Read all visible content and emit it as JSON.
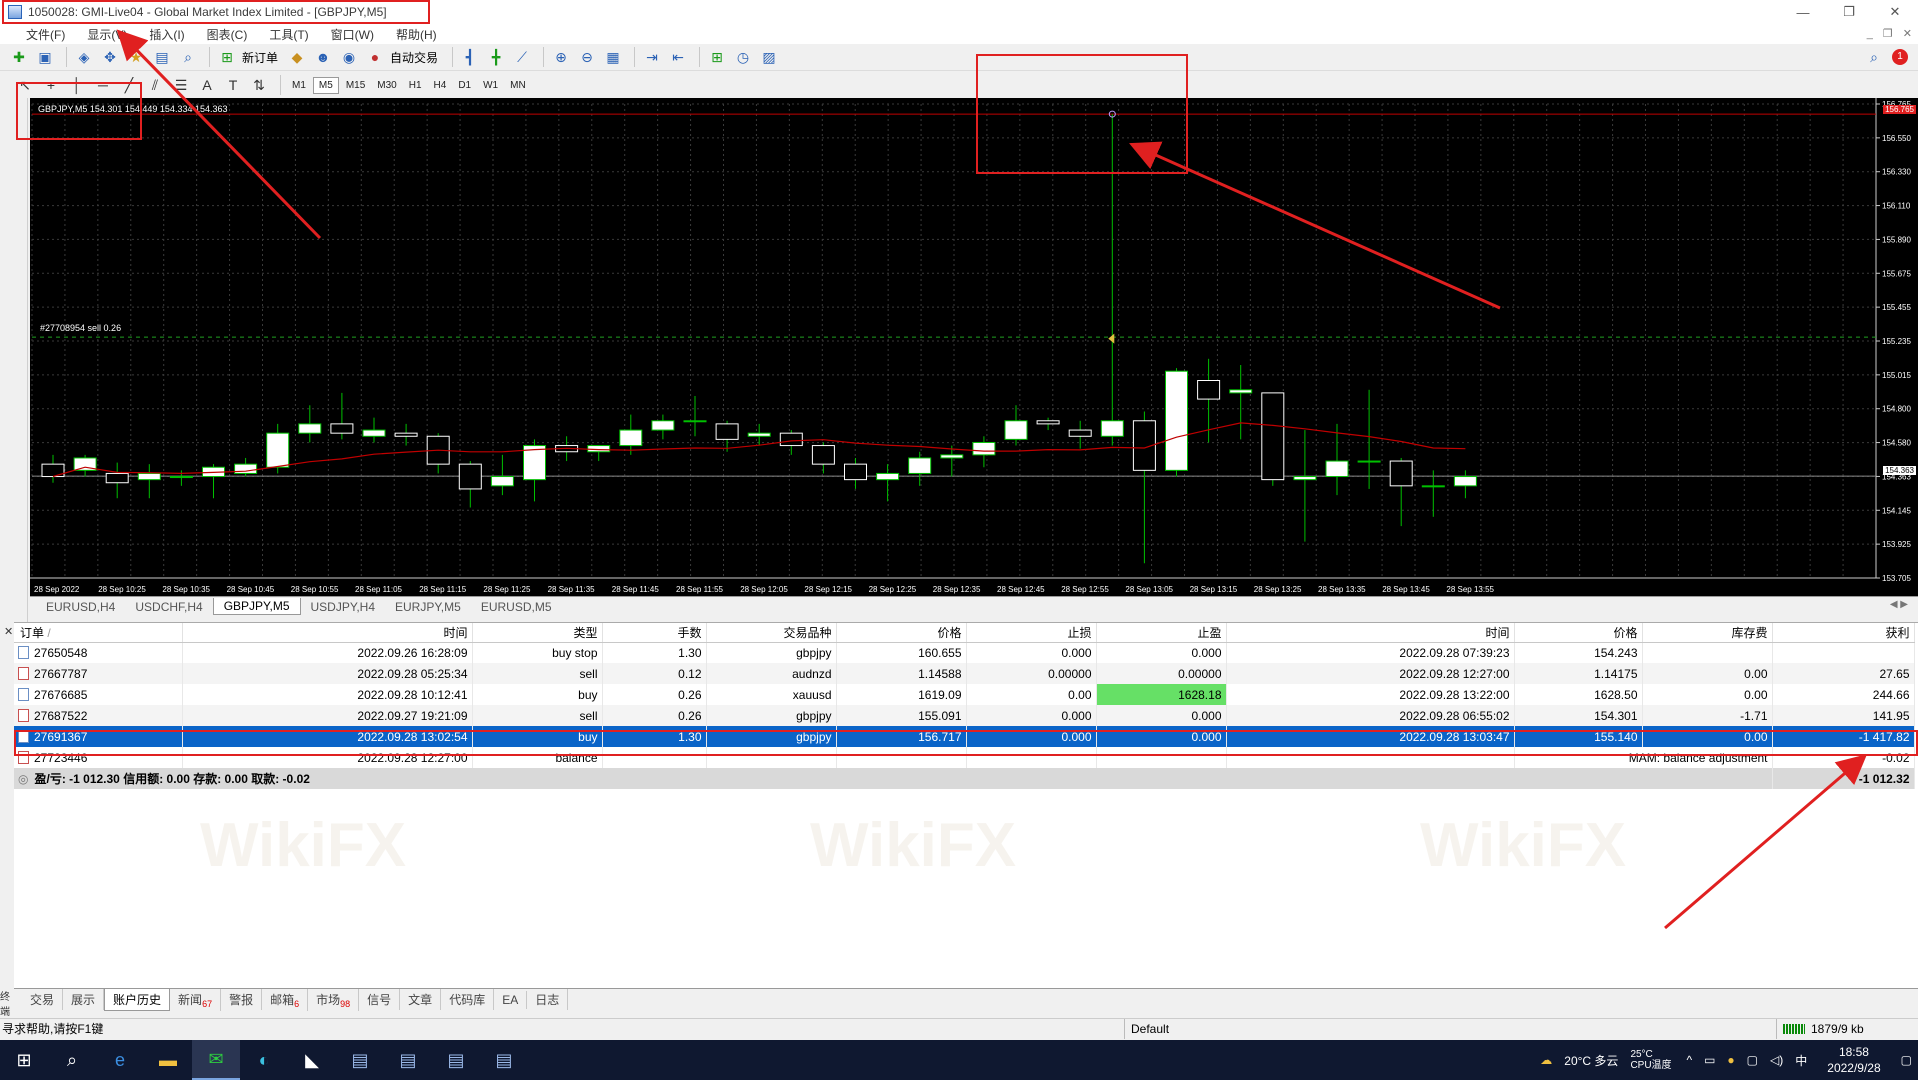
{
  "window": {
    "title": "1050028: GMI-Live04 - Global Market Index Limited - [GBPJPY,M5]",
    "controls": [
      "—",
      "❐",
      "✕"
    ]
  },
  "menu": {
    "items": [
      "文件(F)",
      "显示(V)",
      "插入(I)",
      "图表(C)",
      "工具(T)",
      "窗口(W)",
      "帮助(H)"
    ]
  },
  "toolbar": {
    "new_order_label": "新订单",
    "auto_trade_label": "自动交易"
  },
  "timeframes": [
    "M1",
    "M5",
    "M15",
    "M30",
    "H1",
    "H4",
    "D1",
    "W1",
    "MN"
  ],
  "active_timeframe": "M5",
  "chart": {
    "header": "GBPJPY,M5  154.301 154.449 154.334 154.363",
    "order_line_label": "#27708954 sell 0.26",
    "current_price": "154.363",
    "top_price": "156.765"
  },
  "chart_data": {
    "type": "candlestick",
    "symbol": "GBPJPY",
    "timeframe": "M5",
    "price_ticks": [
      "156.765",
      "156.550",
      "156.330",
      "156.110",
      "155.890",
      "155.675",
      "155.455",
      "155.235",
      "155.015",
      "154.800",
      "154.580",
      "154.363",
      "154.145",
      "153.925",
      "153.705"
    ],
    "time_ticks": [
      "28 Sep 2022",
      "28 Sep 10:25",
      "28 Sep 10:35",
      "28 Sep 10:45",
      "28 Sep 10:55",
      "28 Sep 11:05",
      "28 Sep 11:15",
      "28 Sep 11:25",
      "28 Sep 11:35",
      "28 Sep 11:45",
      "28 Sep 11:55",
      "28 Sep 12:05",
      "28 Sep 12:15",
      "28 Sep 12:25",
      "28 Sep 12:35",
      "28 Sep 12:45",
      "28 Sep 12:55",
      "28 Sep 13:05",
      "28 Sep 13:15",
      "28 Sep 13:25",
      "28 Sep 13:35",
      "28 Sep 13:45",
      "28 Sep 13:55"
    ],
    "ylim": [
      153.705,
      156.765
    ],
    "order_line_price": 155.26,
    "candles": [
      {
        "o": 154.44,
        "h": 154.5,
        "c": 154.36,
        "l": 154.32
      },
      {
        "o": 154.4,
        "h": 154.5,
        "c": 154.48,
        "l": 154.36
      },
      {
        "o": 154.38,
        "h": 154.45,
        "c": 154.32,
        "l": 154.22
      },
      {
        "o": 154.34,
        "h": 154.44,
        "c": 154.38,
        "l": 154.22
      },
      {
        "o": 154.36,
        "h": 154.4,
        "c": 154.36,
        "l": 154.3
      },
      {
        "o": 154.36,
        "h": 154.44,
        "c": 154.42,
        "l": 154.22
      },
      {
        "o": 154.38,
        "h": 154.48,
        "c": 154.44,
        "l": 154.36
      },
      {
        "o": 154.42,
        "h": 154.7,
        "c": 154.64,
        "l": 154.38
      },
      {
        "o": 154.64,
        "h": 154.82,
        "c": 154.7,
        "l": 154.58
      },
      {
        "o": 154.7,
        "h": 154.9,
        "c": 154.64,
        "l": 154.6
      },
      {
        "o": 154.62,
        "h": 154.74,
        "c": 154.66,
        "l": 154.58
      },
      {
        "o": 154.64,
        "h": 154.7,
        "c": 154.62,
        "l": 154.56
      },
      {
        "o": 154.62,
        "h": 154.64,
        "c": 154.44,
        "l": 154.38
      },
      {
        "o": 154.44,
        "h": 154.46,
        "c": 154.28,
        "l": 154.16
      },
      {
        "o": 154.3,
        "h": 154.5,
        "c": 154.36,
        "l": 154.24
      },
      {
        "o": 154.34,
        "h": 154.6,
        "c": 154.56,
        "l": 154.2
      },
      {
        "o": 154.56,
        "h": 154.62,
        "c": 154.52,
        "l": 154.46
      },
      {
        "o": 154.52,
        "h": 154.56,
        "c": 154.56,
        "l": 154.46
      },
      {
        "o": 154.56,
        "h": 154.76,
        "c": 154.66,
        "l": 154.5
      },
      {
        "o": 154.66,
        "h": 154.76,
        "c": 154.72,
        "l": 154.6
      },
      {
        "o": 154.72,
        "h": 154.88,
        "c": 154.72,
        "l": 154.62
      },
      {
        "o": 154.7,
        "h": 154.72,
        "c": 154.6,
        "l": 154.52
      },
      {
        "o": 154.62,
        "h": 154.7,
        "c": 154.64,
        "l": 154.56
      },
      {
        "o": 154.64,
        "h": 154.66,
        "c": 154.56,
        "l": 154.5
      },
      {
        "o": 154.56,
        "h": 154.58,
        "c": 154.44,
        "l": 154.38
      },
      {
        "o": 154.44,
        "h": 154.48,
        "c": 154.34,
        "l": 154.28
      },
      {
        "o": 154.34,
        "h": 154.44,
        "c": 154.38,
        "l": 154.2
      },
      {
        "o": 154.38,
        "h": 154.52,
        "c": 154.48,
        "l": 154.3
      },
      {
        "o": 154.48,
        "h": 154.56,
        "c": 154.5,
        "l": 154.36
      },
      {
        "o": 154.5,
        "h": 154.62,
        "c": 154.58,
        "l": 154.42
      },
      {
        "o": 154.6,
        "h": 154.82,
        "c": 154.72,
        "l": 154.56
      },
      {
        "o": 154.72,
        "h": 154.74,
        "c": 154.7,
        "l": 154.66
      },
      {
        "o": 154.66,
        "h": 154.72,
        "c": 154.62,
        "l": 154.54
      },
      {
        "o": 154.62,
        "h": 156.7,
        "c": 154.72,
        "l": 154.56
      },
      {
        "o": 154.72,
        "h": 154.78,
        "c": 154.4,
        "l": 153.8
      },
      {
        "o": 154.4,
        "h": 155.06,
        "c": 155.04,
        "l": 154.36
      },
      {
        "o": 154.98,
        "h": 155.12,
        "c": 154.86,
        "l": 154.58
      },
      {
        "o": 154.9,
        "h": 155.08,
        "c": 154.92,
        "l": 154.6
      },
      {
        "o": 154.9,
        "h": 154.9,
        "c": 154.34,
        "l": 154.3
      },
      {
        "o": 154.34,
        "h": 154.66,
        "c": 154.36,
        "l": 153.94
      },
      {
        "o": 154.36,
        "h": 154.7,
        "c": 154.46,
        "l": 154.24
      },
      {
        "o": 154.46,
        "h": 154.92,
        "c": 154.46,
        "l": 154.28
      },
      {
        "o": 154.46,
        "h": 154.48,
        "c": 154.3,
        "l": 154.04
      },
      {
        "o": 154.3,
        "h": 154.4,
        "c": 154.3,
        "l": 154.1
      },
      {
        "o": 154.3,
        "h": 154.4,
        "c": 154.36,
        "l": 154.22
      }
    ]
  },
  "chart_tabs": [
    "EURUSD,H4",
    "USDCHF,H4",
    "GBPJPY,M5",
    "USDJPY,H4",
    "EURJPY,M5",
    "EURUSD,M5"
  ],
  "active_chart_tab": "GBPJPY,M5",
  "history": {
    "columns": [
      "订单",
      "时间",
      "类型",
      "手数",
      "交易品种",
      "价格",
      "止损",
      "止盈",
      "时间",
      "价格",
      "库存费",
      "获利"
    ],
    "rows": [
      {
        "ticket": "27650548",
        "open_time": "2022.09.26 16:28:09",
        "type": "buy stop",
        "lots": "1.30",
        "symbol": "gbpjpy",
        "open_price": "160.655",
        "sl": "0.000",
        "tp": "0.000",
        "close_time": "2022.09.28 07:39:23",
        "close_price": "154.243",
        "swap": "",
        "profit": ""
      },
      {
        "ticket": "27667787",
        "open_time": "2022.09.28 05:25:34",
        "type": "sell",
        "lots": "0.12",
        "symbol": "audnzd",
        "open_price": "1.14588",
        "sl": "0.00000",
        "tp": "0.00000",
        "close_time": "2022.09.28 12:27:00",
        "close_price": "1.14175",
        "swap": "0.00",
        "profit": "27.65"
      },
      {
        "ticket": "27676685",
        "open_time": "2022.09.28 10:12:41",
        "type": "buy",
        "lots": "0.26",
        "symbol": "xauusd",
        "open_price": "1619.09",
        "sl": "0.00",
        "tp": "1628.18",
        "close_time": "2022.09.28 13:22:00",
        "close_price": "1628.50",
        "swap": "0.00",
        "profit": "244.66"
      },
      {
        "ticket": "27687522",
        "open_time": "2022.09.27 19:21:09",
        "type": "sell",
        "lots": "0.26",
        "symbol": "gbpjpy",
        "open_price": "155.091",
        "sl": "0.000",
        "tp": "0.000",
        "close_time": "2022.09.28 06:55:02",
        "close_price": "154.301",
        "swap": "-1.71",
        "profit": "141.95"
      },
      {
        "ticket": "27691367",
        "open_time": "2022.09.28 13:02:54",
        "type": "buy",
        "lots": "1.30",
        "symbol": "gbpjpy",
        "open_price": "156.717",
        "sl": "0.000",
        "tp": "0.000",
        "close_time": "2022.09.28 13:03:47",
        "close_price": "155.140",
        "swap": "0.00",
        "profit": "-1 417.82"
      },
      {
        "ticket": "27723446",
        "open_time": "2022.09.28 12:27:00",
        "type": "balance",
        "lots": "",
        "symbol": "",
        "open_price": "",
        "sl": "",
        "tp": "",
        "close_time": "",
        "close_price": "MAM: balance adjustment",
        "swap": "",
        "profit": "-0.02"
      }
    ],
    "summary": "盈/亏: -1 012.30  信用额: 0.00  存款: 0.00  取款: -0.02",
    "summary_total": "-1 012.32"
  },
  "terminal_tabs": [
    {
      "label": "交易",
      "badge": ""
    },
    {
      "label": "展示",
      "badge": ""
    },
    {
      "label": "账户历史",
      "badge": ""
    },
    {
      "label": "新闻",
      "badge": "67"
    },
    {
      "label": "警报",
      "badge": ""
    },
    {
      "label": "邮箱",
      "badge": "6"
    },
    {
      "label": "市场",
      "badge": "98"
    },
    {
      "label": "信号",
      "badge": ""
    },
    {
      "label": "文章",
      "badge": ""
    },
    {
      "label": "代码库",
      "badge": ""
    },
    {
      "label": "EA",
      "badge": ""
    },
    {
      "label": "日志",
      "badge": ""
    }
  ],
  "active_terminal_tab": "账户历史",
  "statusbar": {
    "help": "寻求帮助,请按F1键",
    "profile": "Default",
    "traffic": "1879/9 kb"
  },
  "taskbar": {
    "weather": "20°C",
    "weather_sub": "多云",
    "cpu_label": "25°C CPU温度",
    "ime": "中",
    "time": "18:58",
    "date": "2022/9/28"
  },
  "watermark_text": "WikiFX",
  "colors": {
    "selected_row": "#0a64c8",
    "highlight_cell": "#66e066",
    "annotation": "#e02020",
    "bull_candle": "#ffffff",
    "bear_candle": "#000000",
    "wick": "#00c000",
    "ma_line": "#c00000"
  }
}
